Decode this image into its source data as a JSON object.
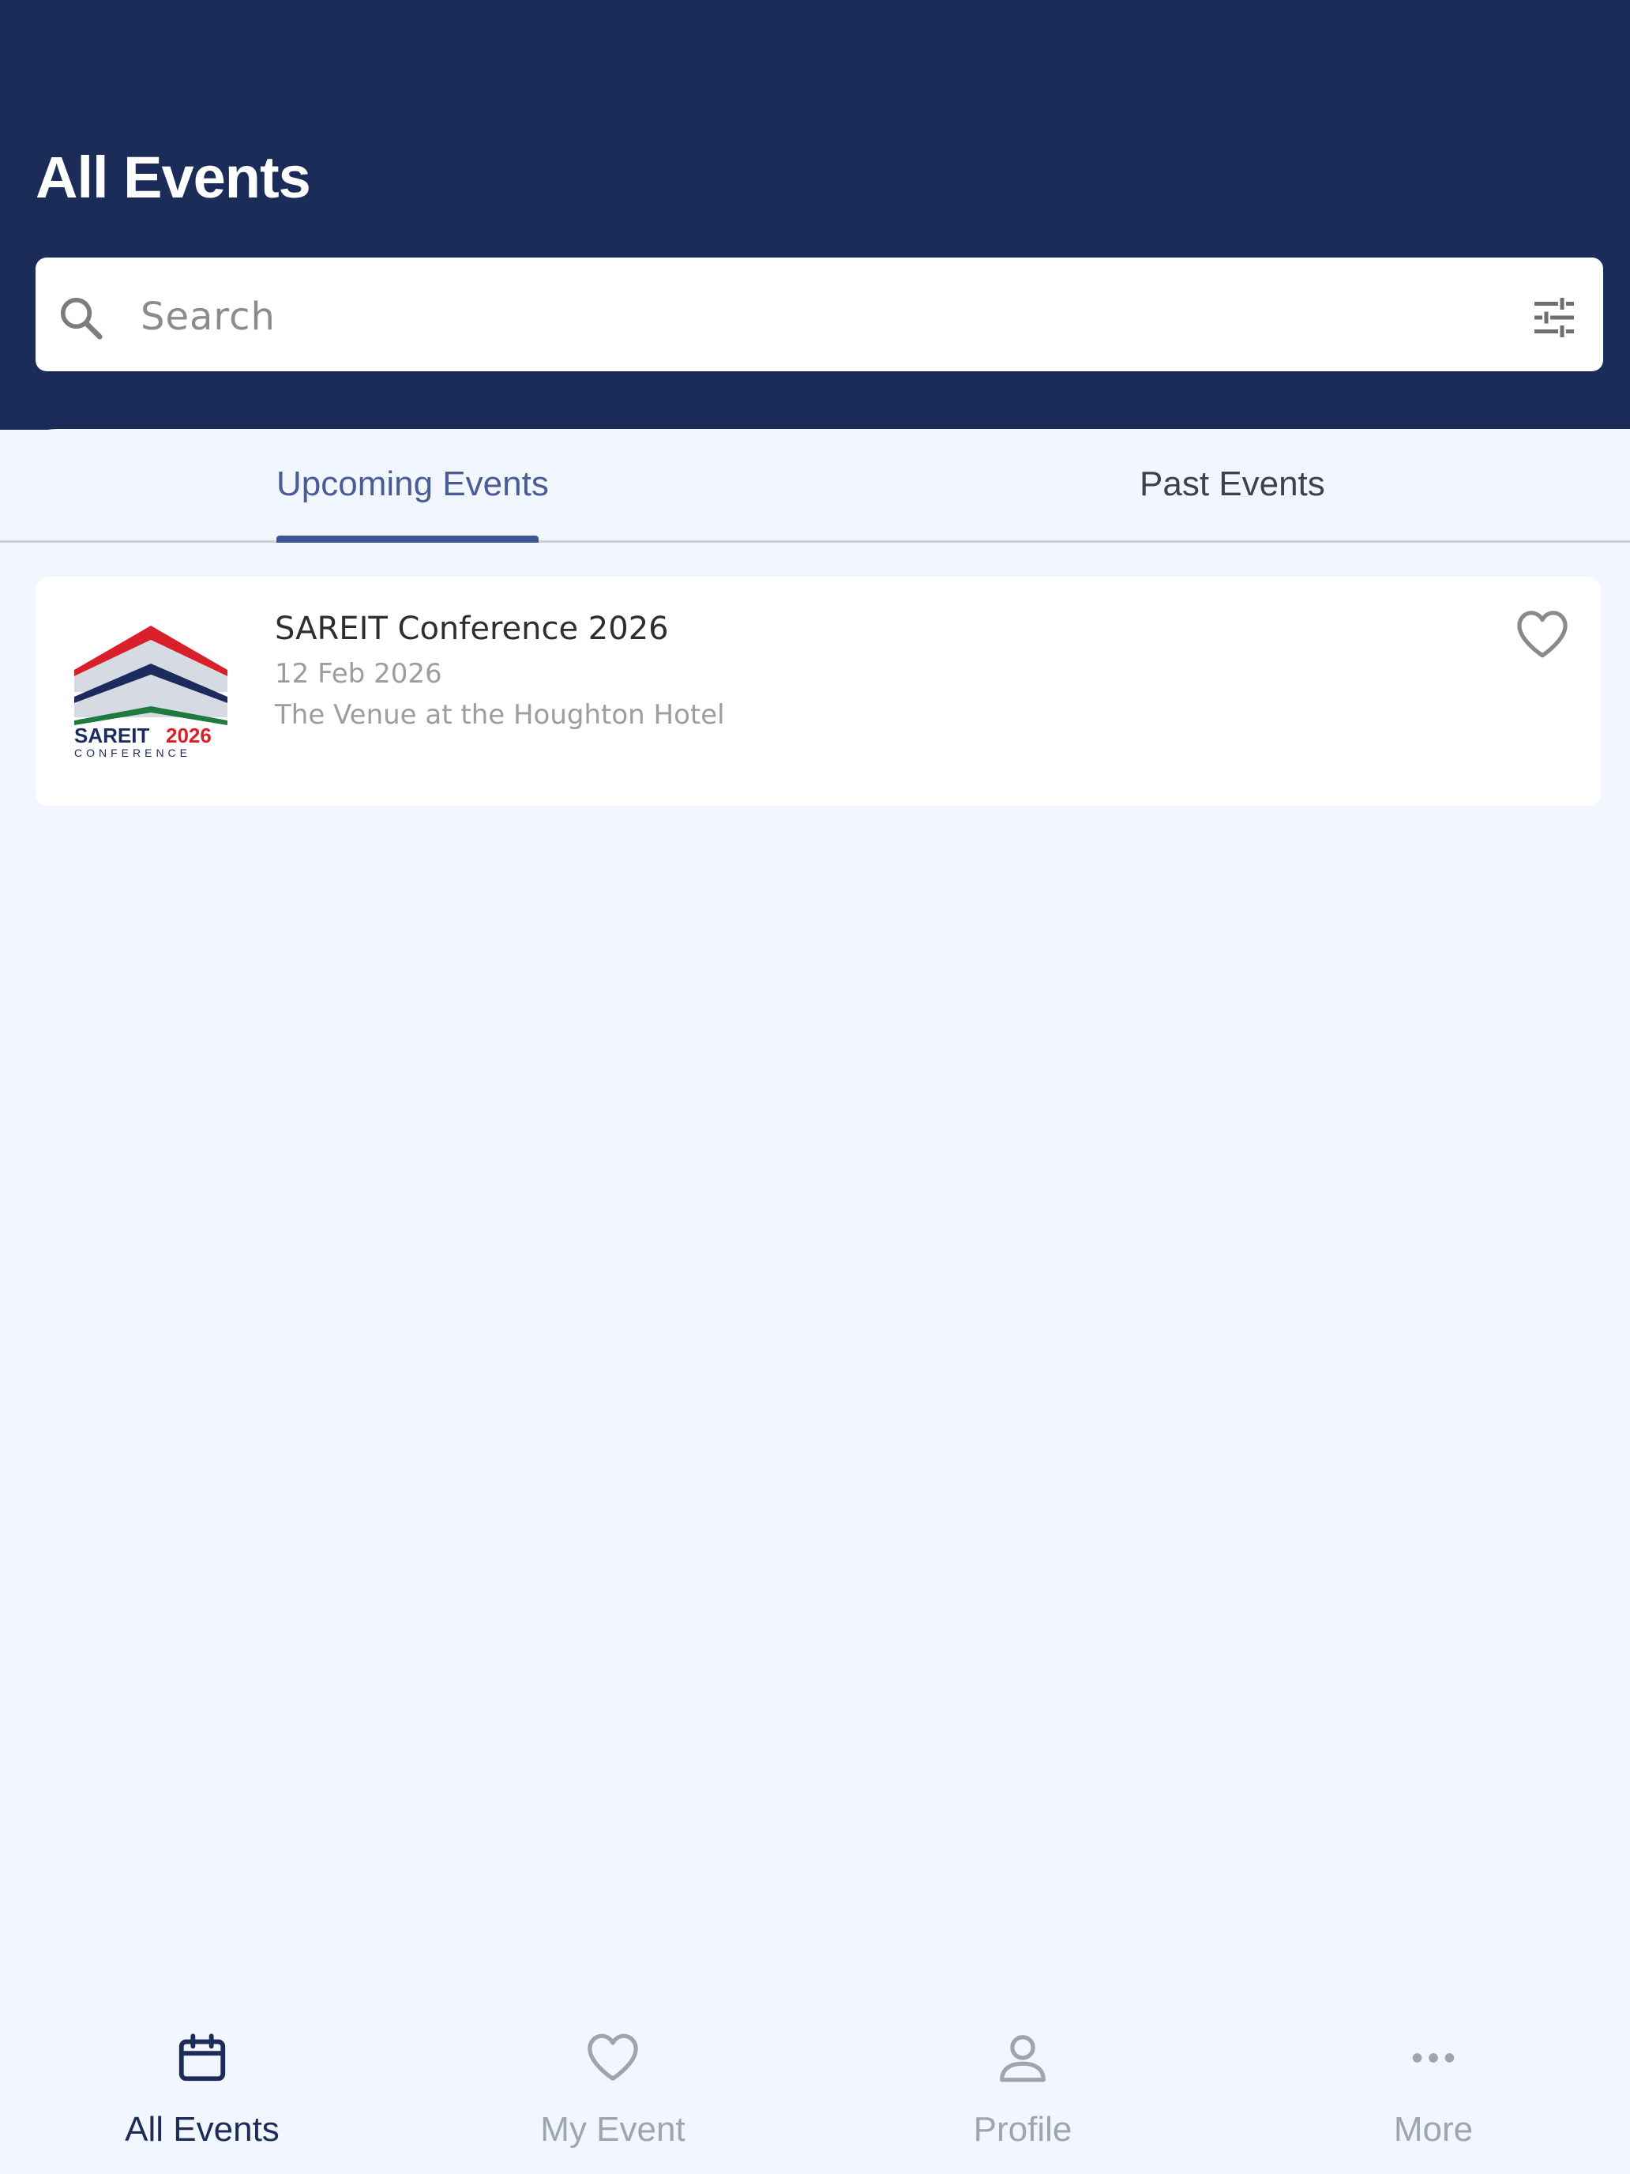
{
  "header": {
    "title": "All Events",
    "background_color": "#1b2c58"
  },
  "search": {
    "placeholder": "Search",
    "value": "",
    "icon": "search-icon",
    "filter_icon": "tune-icon"
  },
  "tabs": [
    {
      "label": "Upcoming Events",
      "active": true
    },
    {
      "label": "Past Events",
      "active": false
    }
  ],
  "events": [
    {
      "name": "SAREIT Conference 2026",
      "date": "12 Feb 2026",
      "venue": "The Venue at the Houghton Hotel",
      "logo": {
        "text_main": "SAREIT",
        "text_year": "2026",
        "text_sub": "CONFERENCE"
      },
      "favorited": false
    }
  ],
  "bottom_nav": [
    {
      "label": "All Events",
      "icon": "calendar-icon",
      "active": true
    },
    {
      "label": "My Event",
      "icon": "heart-icon",
      "active": false
    },
    {
      "label": "Profile",
      "icon": "person-icon",
      "active": false
    },
    {
      "label": "More",
      "icon": "more-horizontal-icon",
      "active": false
    }
  ],
  "colors": {
    "primary": "#1b2c58",
    "accent": "#3f5696",
    "background": "#f2f6fe",
    "logo_red": "#d9202a",
    "logo_navy": "#1c2b5e",
    "logo_green": "#1f7a3e"
  }
}
